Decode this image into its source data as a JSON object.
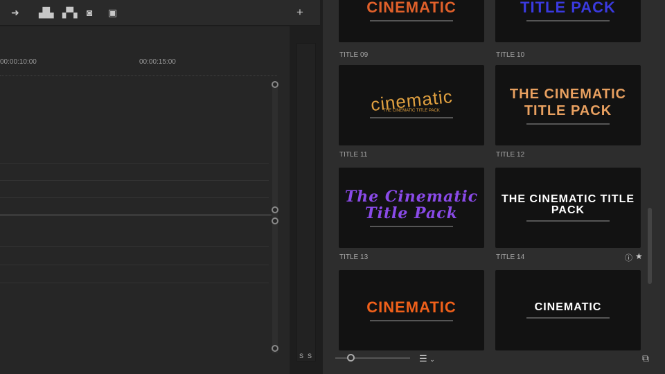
{
  "toolbar": {
    "icons": [
      "extract-icon",
      "lift-icon",
      "overwrite-icon",
      "camera-icon",
      "compare-icon",
      "plus-icon"
    ]
  },
  "timeline": {
    "timecodes": [
      "00:00:10:00",
      "00:00:15:00"
    ]
  },
  "meter": {
    "solo_labels": [
      "S",
      "S"
    ]
  },
  "titles": [
    {
      "label": "TITLE 09",
      "text": "CINEMATIC",
      "color": "#e0602a"
    },
    {
      "label": "TITLE 10",
      "text": "TITLE PACK",
      "color": "#3a3adf"
    },
    {
      "label": "TITLE 11",
      "text": "cinematic",
      "sub": "THE CINEMATIC TITLE PACK",
      "color": "#e0a040"
    },
    {
      "label": "TITLE 12",
      "text": "THE CINEMATIC TITLE PACK",
      "color": "#e8a060"
    },
    {
      "label": "TITLE 13",
      "text": "The Cinematic Title Pack",
      "color": "#8a4ae8"
    },
    {
      "label": "TITLE 14",
      "text": "THE CINEMATIC TITLE PACK",
      "color": "#ffffff"
    },
    {
      "label": "",
      "text": "CINEMATIC",
      "color": "#f0601a"
    },
    {
      "label": "",
      "text": "CINEMATIC",
      "color": "#ffffff"
    }
  ]
}
